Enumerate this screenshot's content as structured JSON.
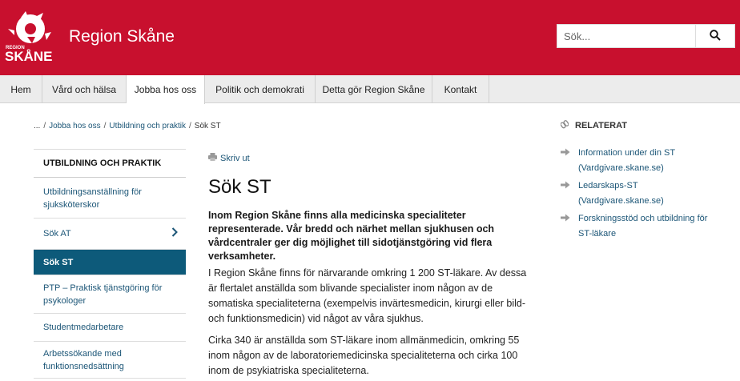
{
  "header": {
    "logo_small_text": "REGION",
    "logo_big_text": "SKÅNE",
    "site_title": "Region Skåne",
    "search_placeholder": "Sök...",
    "search_icon": "search-icon",
    "brand_color": "#c8102e"
  },
  "nav": {
    "items": [
      {
        "label": "Hem"
      },
      {
        "label": "Vård och hälsa"
      },
      {
        "label": "Jobba hos oss"
      },
      {
        "label": "Politik och demokrati"
      },
      {
        "label": "Detta gör Region Skåne"
      },
      {
        "label": "Kontakt"
      }
    ],
    "active_index": 2
  },
  "breadcrumb": {
    "items": [
      "...",
      "Jobba hos oss",
      "Utbildning och praktik",
      "Sök ST"
    ],
    "separator": "/"
  },
  "sidebar": {
    "heading": "UTBILDNING OCH PRAKTIK",
    "items": [
      {
        "label": "Utbildningsanställning för sjuksköterskor"
      },
      {
        "label": "Sök AT",
        "has_chevron": true
      },
      {
        "label": "Sök ST",
        "active": true
      },
      {
        "label": "PTP – Praktisk tjänstgöring för psykologer"
      },
      {
        "label": "Studentmedarbetare"
      },
      {
        "label": "Arbetssökande med funktionsnedsättning"
      }
    ],
    "active_color": "#0d5a7a",
    "chevron_icon": "chevron-right-icon"
  },
  "main": {
    "print_label": "Skriv ut",
    "print_icon": "printer-icon",
    "title": "Sök ST",
    "lead": "Inom Region Skåne finns alla medicinska specialiteter representerade. Vår bredd och närhet mellan sjukhusen och vårdcentraler ger dig möjlighet till sidotjänstgöring vid flera verksamheter.",
    "paragraphs": [
      "I Region Skåne finns för närvarande omkring 1 200 ST-läkare. Av dessa är flertalet anställda som blivande specialister inom någon av de somatiska specialiteterna (exempelvis invärtesmedicin, kirurgi eller bild- och funktionsmedicin) vid något av våra sjukhus.",
      "Cirka 340 är anställda som ST-läkare inom allmänmedicin, omkring 55 inom någon av de laboratoriemedicinska specialiteterna och cirka 100 inom de psykiatriska specialiteterna."
    ]
  },
  "related": {
    "heading": "RELATERAT",
    "heading_icon": "link-icon",
    "arrow_icon": "arrow-right-icon",
    "items": [
      {
        "label": "Information under din ST (Vardgivare.skane.se)"
      },
      {
        "label": "Ledarskaps-ST (Vardgivare.skane.se)"
      },
      {
        "label": "Forskningsstöd och utbildning för ST-läkare"
      }
    ]
  }
}
